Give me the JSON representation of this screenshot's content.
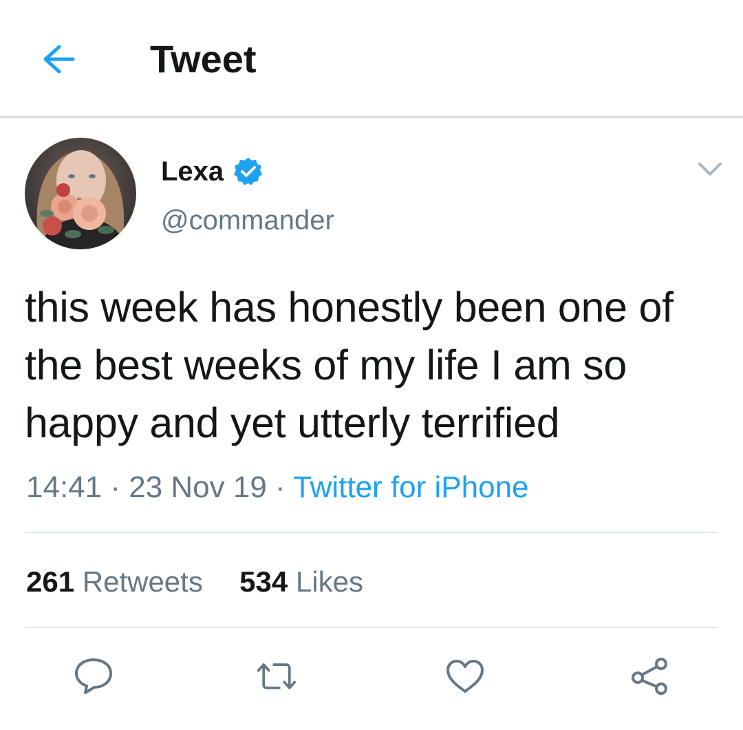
{
  "header": {
    "title": "Tweet",
    "back_icon": "arrow-left-icon"
  },
  "colors": {
    "accent": "#1da1f2",
    "text_primary": "#14171a",
    "text_secondary": "#657786",
    "divider": "#e1e8ed",
    "verified": "#1da1f2"
  },
  "author": {
    "name": "Lexa",
    "handle": "@commander",
    "verified": true,
    "avatar_icon": "avatar-photo"
  },
  "tweet": {
    "text": "this week has honestly been one of the best weeks of my life I am so happy and yet utterly terrified",
    "time": "14:41",
    "separator": "·",
    "date": "23 Nov 19",
    "source": "Twitter for iPhone"
  },
  "stats": {
    "retweets_count": "261",
    "retweets_label": "Retweets",
    "likes_count": "534",
    "likes_label": "Likes"
  },
  "actions": [
    {
      "name": "reply",
      "icon": "speech-bubble-icon"
    },
    {
      "name": "retweet",
      "icon": "retweet-icon"
    },
    {
      "name": "like",
      "icon": "heart-icon"
    },
    {
      "name": "share",
      "icon": "share-icon"
    }
  ]
}
